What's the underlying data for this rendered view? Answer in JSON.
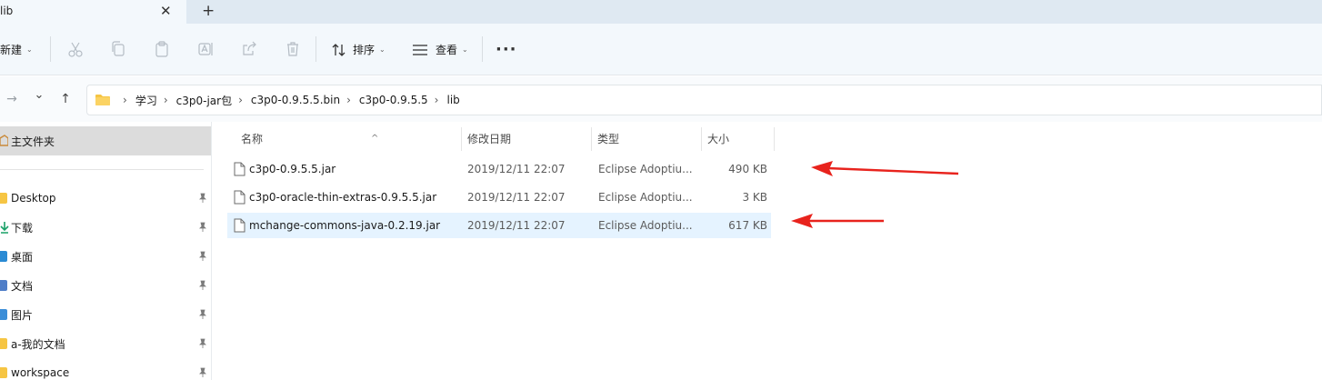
{
  "tab": {
    "title": "lib",
    "close_glyph": "✕",
    "new_tab_glyph": "+"
  },
  "toolbar": {
    "new_label": "新建",
    "sort_label": "排序",
    "view_label": "查看",
    "more_glyph": "···",
    "icons": [
      "cut-icon",
      "copy-icon",
      "paste-icon",
      "rename-icon",
      "share-icon",
      "delete-icon"
    ]
  },
  "nav": {
    "forward_glyph": "→",
    "recent_glyph": "⌄",
    "up_glyph": "↑"
  },
  "breadcrumb": [
    "学习",
    "c3p0-jar包",
    "c3p0-0.9.5.5.bin",
    "c3p0-0.9.5.5",
    "lib"
  ],
  "sidebar": {
    "home_label": "主文件夹",
    "items": [
      {
        "label": "Desktop",
        "color": "#f6c543"
      },
      {
        "label": "下载",
        "color": "#18a067"
      },
      {
        "label": "桌面",
        "color": "#2a8ad4"
      },
      {
        "label": "文档",
        "color": "#4f7ec8"
      },
      {
        "label": "图片",
        "color": "#3b8ed8"
      },
      {
        "label": "a-我的文档",
        "color": "#f6c543"
      },
      {
        "label": "workspace",
        "color": "#f6c543"
      }
    ]
  },
  "columns": {
    "name": "名称",
    "date": "修改日期",
    "type": "类型",
    "size": "大小"
  },
  "files": [
    {
      "name": "c3p0-0.9.5.5.jar",
      "date": "2019/12/11 22:07",
      "type": "Eclipse Adoptiu...",
      "size": "490 KB"
    },
    {
      "name": "c3p0-oracle-thin-extras-0.9.5.5.jar",
      "date": "2019/12/11 22:07",
      "type": "Eclipse Adoptiu...",
      "size": "3 KB"
    },
    {
      "name": "mchange-commons-java-0.2.19.jar",
      "date": "2019/12/11 22:07",
      "type": "Eclipse Adoptiu...",
      "size": "617 KB"
    }
  ],
  "colors": {
    "accent_select": "#e5f3ff",
    "annotation_arrow": "#e8231d",
    "folder": "#f6c543"
  }
}
